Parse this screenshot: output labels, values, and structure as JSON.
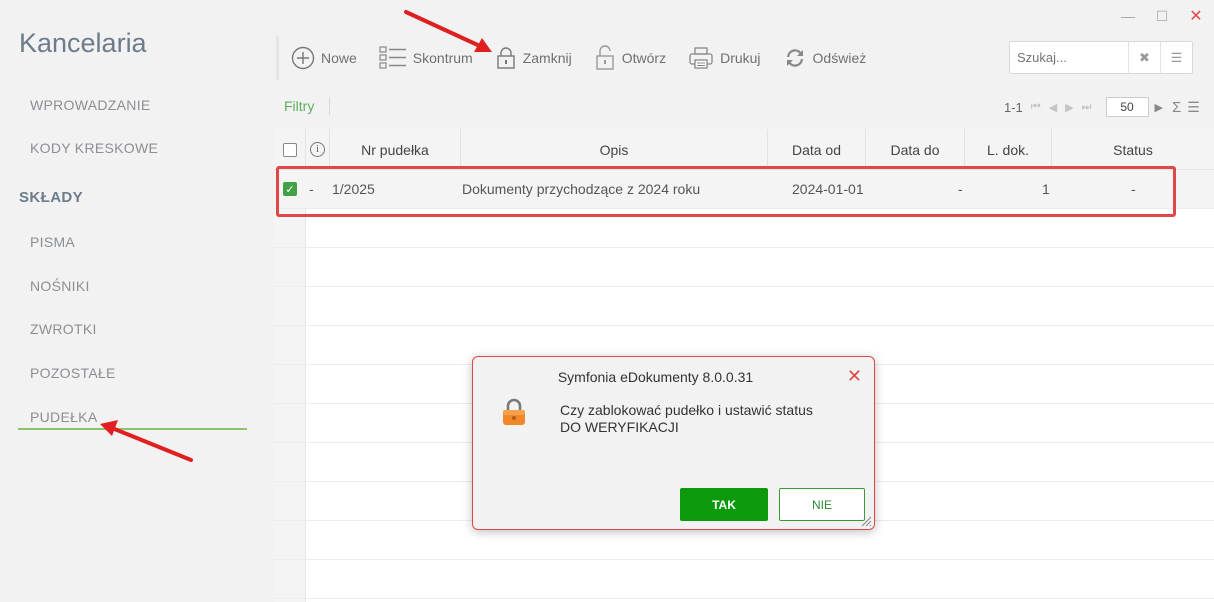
{
  "window": {
    "minimize": "—",
    "maximize": "☐",
    "close": "✕"
  },
  "app_title": "Kancelaria",
  "sidebar": {
    "items_top": [
      "WPROWADZANIE",
      "KODY KRESKOWE"
    ],
    "section": "SKŁADY",
    "items": [
      "PISMA",
      "NOŚNIKI",
      "ZWROTKI",
      "POZOSTAŁE",
      "PUDEŁKA"
    ],
    "active": "PUDEŁKA"
  },
  "toolbar": {
    "new": "Nowe",
    "skontrum": "Skontrum",
    "close": "Zamknij",
    "open": "Otwórz",
    "print": "Drukuj",
    "refresh": "Odśwież"
  },
  "search": {
    "placeholder": "Szukaj..."
  },
  "filters": {
    "label": "Filtry"
  },
  "pager": {
    "range": "1-1",
    "page_size": "50"
  },
  "table": {
    "columns": [
      "Nr pudełka",
      "Opis",
      "Data od",
      "Data do",
      "L. dok.",
      "Status"
    ],
    "rows": [
      {
        "marker": "-",
        "nr": "1/2025",
        "opis": "Dokumenty przychodzące z 2024 roku",
        "data_od": "2024-01-01",
        "data_do": "-",
        "l_dok": "1",
        "status": "-"
      }
    ]
  },
  "dialog": {
    "title": "Symfonia eDokumenty 8.0.0.31",
    "message_line1": "Czy zablokować pudełko i ustawić status",
    "message_line2": "DO WERYFIKACJI",
    "yes": "TAK",
    "no": "NIE"
  },
  "colors": {
    "accent_green": "#0c9a0c",
    "annotation_red": "#e04848",
    "lock_orange": "#f0882a"
  }
}
